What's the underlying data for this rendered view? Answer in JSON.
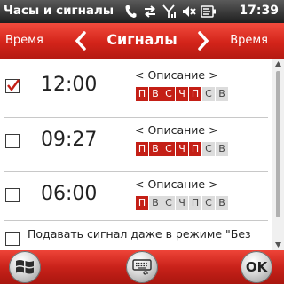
{
  "statusbar": {
    "title": "Часы и сигналы",
    "time": "17:39",
    "icons": [
      "phone-icon",
      "sync-icon",
      "signal-icon",
      "volume-muted-icon",
      "battery-icon"
    ]
  },
  "header": {
    "prev_tab": "Время",
    "current_tab": "Сигналы",
    "next_tab": "Время"
  },
  "alarms": [
    {
      "time": "12:00",
      "description": "< Описание >",
      "enabled": true,
      "days": [
        {
          "label": "П",
          "active": true
        },
        {
          "label": "В",
          "active": true
        },
        {
          "label": "С",
          "active": true
        },
        {
          "label": "Ч",
          "active": true
        },
        {
          "label": "П",
          "active": true
        },
        {
          "label": "С",
          "active": false
        },
        {
          "label": "В",
          "active": false
        }
      ]
    },
    {
      "time": "09:27",
      "description": "< Описание >",
      "enabled": false,
      "days": [
        {
          "label": "П",
          "active": true
        },
        {
          "label": "В",
          "active": true
        },
        {
          "label": "С",
          "active": true
        },
        {
          "label": "Ч",
          "active": true
        },
        {
          "label": "П",
          "active": true
        },
        {
          "label": "С",
          "active": false
        },
        {
          "label": "В",
          "active": false
        }
      ]
    },
    {
      "time": "06:00",
      "description": "< Описание >",
      "enabled": false,
      "days": [
        {
          "label": "П",
          "active": true
        },
        {
          "label": "В",
          "active": false
        },
        {
          "label": "С",
          "active": false
        },
        {
          "label": "Ч",
          "active": false
        },
        {
          "label": "П",
          "active": false
        },
        {
          "label": "С",
          "active": false
        },
        {
          "label": "В",
          "active": false
        }
      ]
    }
  ],
  "silent_option": {
    "label": "Подавать сигнал даже в режиме \"Без"
  },
  "bottombar": {
    "start_icon": "windows-start-icon",
    "keyboard_icon": "keyboard-icon",
    "ok_label": "OK"
  },
  "colors": {
    "accent": "#c41f16",
    "inactive_day": "#dcdcdc"
  }
}
